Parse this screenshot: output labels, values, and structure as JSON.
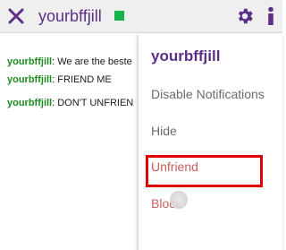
{
  "header": {
    "title": "yourbffjill",
    "online_color": "#19b34c",
    "close_icon": "close-icon",
    "settings_icon": "gear-icon",
    "info_icon": "info-icon"
  },
  "messages": [
    {
      "user": "yourbffjill",
      "text": ": We are the beste"
    },
    {
      "user": "yourbffjill",
      "text": ": FRIEND ME"
    },
    {
      "user": "yourbffjill",
      "text": ": DON'T UNFRIEN"
    }
  ],
  "menu": {
    "header": "yourbffjill",
    "items": [
      {
        "label": "Disable Notifications"
      },
      {
        "label": "Hide"
      },
      {
        "label": "Unfriend"
      },
      {
        "label": "Block"
      }
    ]
  },
  "colors": {
    "accent": "#5d2f86",
    "username": "#1c8a1c",
    "danger": "#c8605c",
    "highlight": "#e00000"
  }
}
